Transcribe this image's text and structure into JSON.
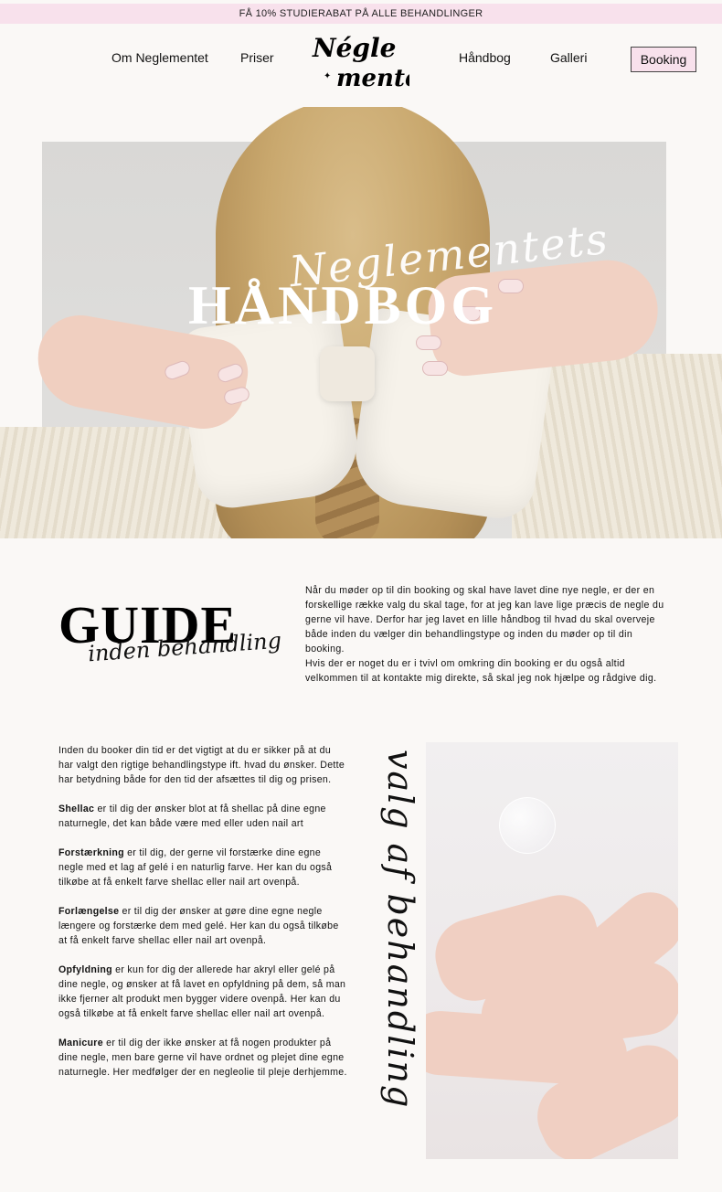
{
  "promo": {
    "text": "FÅ 10% STUDIERABAT PÅ ALLE BEHANDLINGER"
  },
  "nav": {
    "items": [
      {
        "label": "Om Neglementet"
      },
      {
        "label": "Priser"
      },
      {
        "label": "Håndbog"
      },
      {
        "label": "Galleri"
      }
    ],
    "booking_label": "Booking"
  },
  "logo": {
    "text": "Négle mentet"
  },
  "hero": {
    "script": "Neglementets",
    "title": "HÅNDBOG"
  },
  "guide": {
    "title": "GUIDE",
    "script": "inden behandling",
    "intro_1": "Når du møder op til din booking og skal have lavet dine nye negle, er der en forskellige række valg du skal tage, for at jeg kan lave lige præcis de negle du gerne vil have. Derfor har jeg lavet en lille håndbog til hvad du skal overveje både inden du vælger din behandlingstype og inden du møder op til din booking.",
    "intro_2": "Hvis der er noget du er i tvivl om omkring din booking er du også altid velkommen til at kontakte mig direkte, så skal jeg nok hjælpe og rådgive dig."
  },
  "types": {
    "intro": "Inden du booker din tid er det vigtigt at du er sikker på at du har valgt den rigtige behandlingstype ift. hvad du ønsker. Dette har betydning både for den tid der afsættes til dig og prisen.",
    "items": [
      {
        "name": "Shellac",
        "text": " er til dig der ønsker blot at få shellac på dine egne naturnegle, det kan både være med eller uden nail art"
      },
      {
        "name": "Forstærkning",
        "text": " er til dig, der gerne vil forstærke dine egne negle med et lag af gelé i en naturlig farve. Her kan du også tilkøbe at få enkelt farve shellac eller nail art ovenpå."
      },
      {
        "name": "Forlængelse",
        "text": " er til dig der ønsker at gøre dine egne negle længere og forstærke dem med gelé. Her kan du også tilkøbe at få enkelt farve shellac eller nail art ovenpå."
      },
      {
        "name": "Opfyldning",
        "text": " er kun for dig der allerede har akryl eller gelé på dine negle, og ønsker at få lavet en opfyldning på dem, så man ikke fjerner alt produkt men bygger videre ovenpå. Her kan du også tilkøbe at få enkelt farve shellac eller nail art ovenpå."
      },
      {
        "name": "Manicure",
        "text": " er til dig der ikke ønsker at få nogen produkter på dine negle, men bare gerne vil have ordnet og plejet dine egne naturnegle. Her medfølger der en negleolie til pleje derhjemme."
      }
    ],
    "vertical_script": "valg af behandling"
  },
  "colors": {
    "promo_bg": "#f8e1ec",
    "page_bg": "#faf8f6",
    "text": "#111111"
  }
}
